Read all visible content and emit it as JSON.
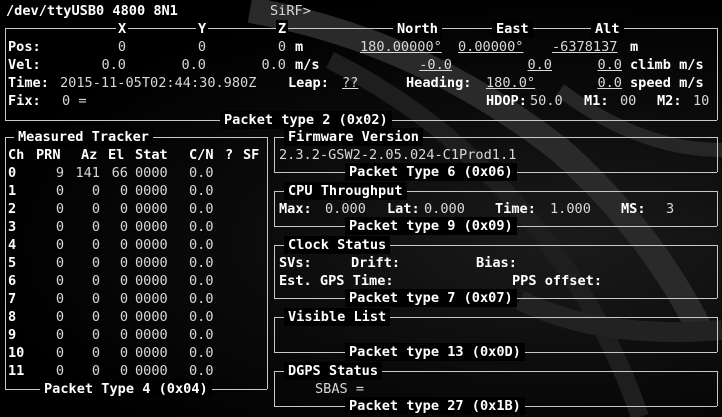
{
  "header": {
    "device": "/dev/ttyUSB0 4800 8N1",
    "mode": "SiRF>"
  },
  "ecef": {
    "col_x": "X",
    "col_y": "Y",
    "col_z": "Z",
    "col_north": "North",
    "col_east": "East",
    "col_alt": "Alt",
    "pos_label": "Pos:",
    "pos_x": "0",
    "pos_y": "0",
    "pos_z": "0",
    "pos_unit": "m",
    "pos_north": "180.00000°",
    "pos_east": "0.00000°",
    "pos_alt": "-6378137",
    "pos_alt_unit": "m",
    "vel_label": "Vel:",
    "vel_x": "0.0",
    "vel_y": "0.0",
    "vel_z": "0.0",
    "vel_unit": "m/s",
    "vel_north": "-0.0",
    "vel_east": "0.0",
    "vel_alt": "0.0",
    "vel_alt_unit": "climb m/s",
    "time_label": "Time:",
    "time_value": "2015-11-05T02:44:30.980Z",
    "leap_label": "Leap:",
    "leap_value": "??",
    "heading_label": "Heading:",
    "heading_value": "180.0°",
    "speed_value": "0.0",
    "speed_unit": "speed m/s",
    "fix_label": "Fix:",
    "fix_value": "0 =",
    "hdop_label": "HDOP:",
    "hdop_value": "50.0",
    "m1_label": "M1:",
    "m1_value": "00",
    "m2_label": "M2:",
    "m2_value": "10",
    "footer": "Packet type 2 (0x02)"
  },
  "tracker": {
    "title": "Measured Tracker",
    "headers": [
      "Ch",
      "PRN",
      "Az",
      "El",
      "Stat",
      "C/N",
      "?",
      "SF"
    ],
    "rows": [
      [
        "0",
        "9",
        "141",
        "66",
        "0000",
        "0.0"
      ],
      [
        "1",
        "0",
        "0",
        "0",
        "0000",
        "0.0"
      ],
      [
        "2",
        "0",
        "0",
        "0",
        "0000",
        "0.0"
      ],
      [
        "3",
        "0",
        "0",
        "0",
        "0000",
        "0.0"
      ],
      [
        "4",
        "0",
        "0",
        "0",
        "0000",
        "0.0"
      ],
      [
        "5",
        "0",
        "0",
        "0",
        "0000",
        "0.0"
      ],
      [
        "6",
        "0",
        "0",
        "0",
        "0000",
        "0.0"
      ],
      [
        "7",
        "0",
        "0",
        "0",
        "0000",
        "0.0"
      ],
      [
        "8",
        "0",
        "0",
        "0",
        "0000",
        "0.0"
      ],
      [
        "9",
        "0",
        "0",
        "0",
        "0000",
        "0.0"
      ],
      [
        "10",
        "0",
        "0",
        "0",
        "0000",
        "0.0"
      ],
      [
        "11",
        "0",
        "0",
        "0",
        "0000",
        "0.0"
      ]
    ],
    "footer": "Packet Type 4 (0x04)"
  },
  "firmware": {
    "title": "Firmware Version",
    "value": "2.3.2-GSW2-2.05.024-C1Prod1.1",
    "footer": "Packet Type 6 (0x06)"
  },
  "cpu": {
    "title": "CPU Throughput",
    "max_label": "Max:",
    "max_value": "0.000",
    "lat_label": "Lat:",
    "lat_value": "0.000",
    "time_label": "Time:",
    "time_value": "1.000",
    "ms_label": "MS:",
    "ms_value": "3",
    "footer": "Packet type 9 (0x09)"
  },
  "clock": {
    "title": "Clock Status",
    "svs_label": "SVs:",
    "drift_label": "Drift:",
    "bias_label": "Bias:",
    "est_label": "Est. GPS Time:",
    "pps_label": "PPS offset:",
    "footer": "Packet type 7 (0x07)"
  },
  "visible": {
    "title": "Visible List",
    "footer": "Packet type 13 (0x0D)"
  },
  "dgps": {
    "title": "DGPS Status",
    "sbas_label": "SBAS =",
    "footer": "Packet type 27 (0x1B)"
  },
  "colors": {
    "background": "#000000",
    "text": "#d8d8d8",
    "bold": "#ffffff",
    "rule": "#c8c8c8"
  }
}
